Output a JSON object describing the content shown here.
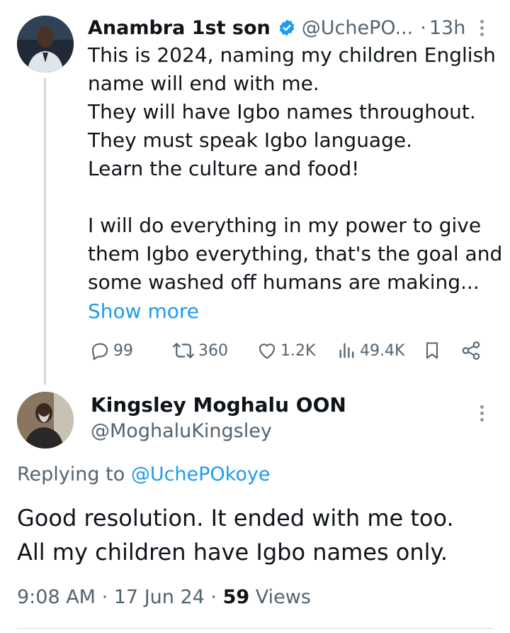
{
  "tweet1": {
    "name": "Anambra 1st son",
    "handle": "@UchePO...",
    "separator": "·",
    "time": "13h",
    "lines": [
      "This is 2024, naming my children English",
      "name will end with me.",
      "They will have Igbo names throughout.",
      "They must speak Igbo language.",
      "Learn the culture and food!",
      "I will do everything in my power to give",
      "them Igbo everything, that's the goal and",
      "some washed off humans are making..."
    ],
    "show_more": "Show more",
    "actions": {
      "replies": "99",
      "reposts": "360",
      "likes": "1.2K",
      "views": "49.4K"
    }
  },
  "tweet2": {
    "name": "Kingsley Moghalu OON",
    "handle": "@MoghaluKingsley",
    "replying_prefix": "Replying to",
    "replying_mention": "@UchePOkoye",
    "lines": [
      "Good resolution. It ended with me too.",
      "All my children have Igbo names only."
    ],
    "time": "9:08 AM",
    "date": "17 Jun 24",
    "views_count": "59",
    "views_label": "Views"
  },
  "colors": {
    "text": "#0f1419",
    "secondary": "#536471",
    "accent": "#1d9bf0",
    "thread_line": "#cfd9de"
  },
  "icons": [
    "verified-badge-icon",
    "reply-icon",
    "repost-icon",
    "like-icon",
    "views-icon",
    "bookmark-icon",
    "share-icon",
    "more-icon"
  ]
}
